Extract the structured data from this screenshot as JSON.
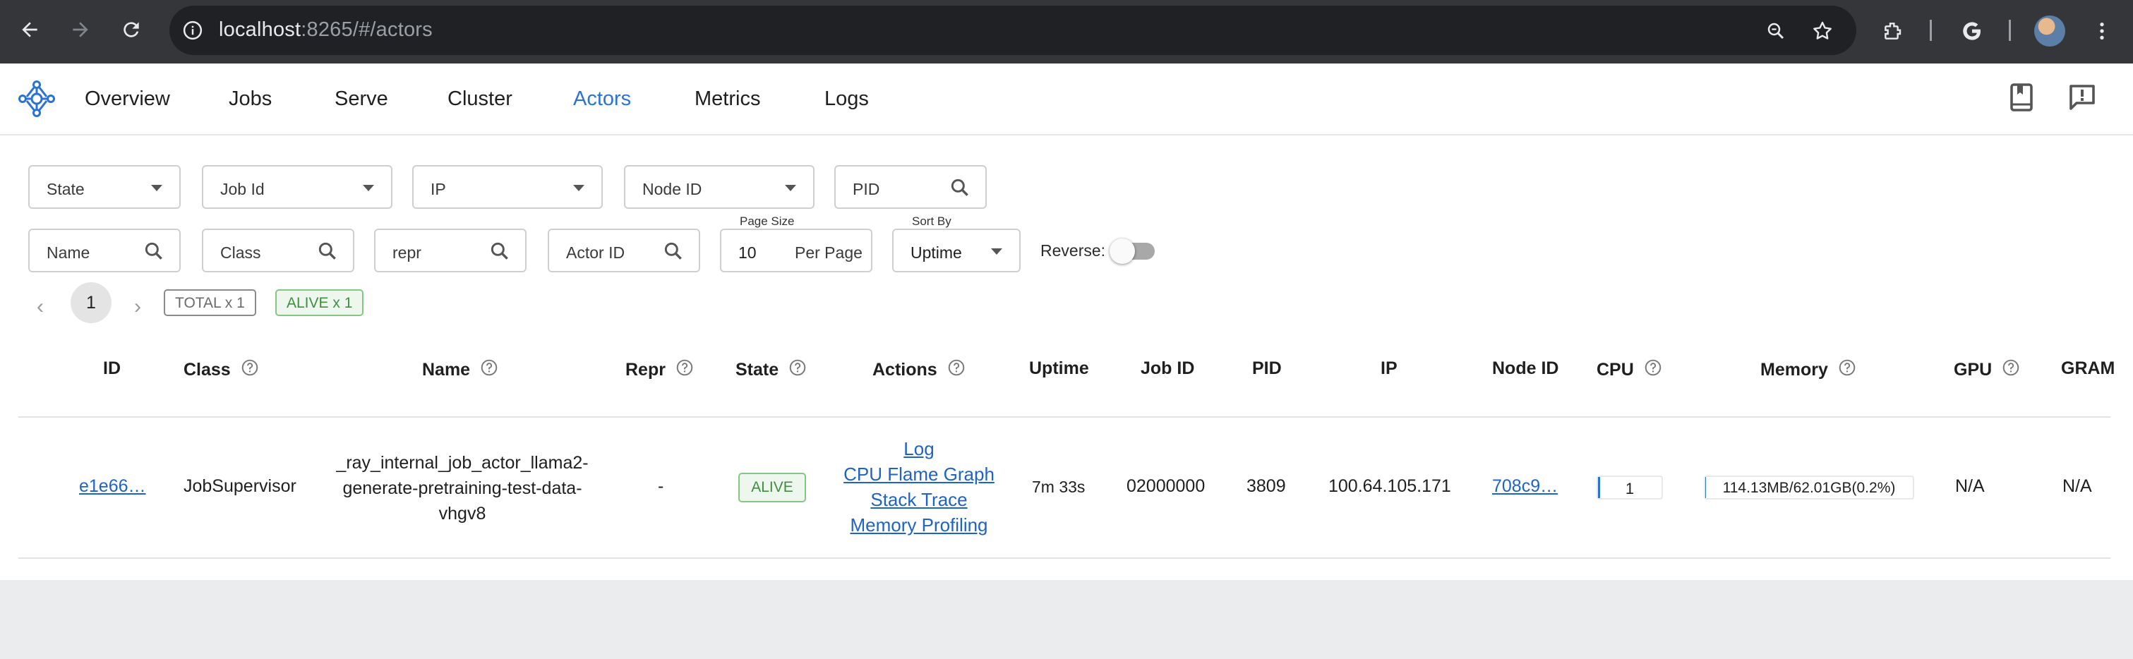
{
  "browser": {
    "url_host": "localhost",
    "url_rest": ":8265/#/actors"
  },
  "nav": {
    "items": [
      "Overview",
      "Jobs",
      "Serve",
      "Cluster",
      "Actors",
      "Metrics",
      "Logs"
    ],
    "active": "Actors"
  },
  "filters": {
    "state": "State",
    "job_id": "Job Id",
    "ip": "IP",
    "node_id": "Node ID",
    "pid": "PID",
    "name": "Name",
    "class": "Class",
    "repr": "repr",
    "actor_id": "Actor ID",
    "page_size_label": "Page Size",
    "page_size_value": "10",
    "page_size_suffix": "Per Page",
    "sort_by_label": "Sort By",
    "sort_by_value": "Uptime",
    "reverse_label": "Reverse:",
    "reverse_on": false
  },
  "pagination": {
    "prev": "‹",
    "page": "1",
    "next": "›",
    "total_chip": "TOTAL x 1",
    "alive_chip": "ALIVE x 1"
  },
  "table": {
    "headers": {
      "id": "ID",
      "class": "Class",
      "name": "Name",
      "repr": "Repr",
      "state": "State",
      "actions": "Actions",
      "uptime": "Uptime",
      "job_id": "Job ID",
      "pid": "PID",
      "ip": "IP",
      "node_id": "Node ID",
      "cpu": "CPU",
      "memory": "Memory",
      "gpu": "GPU",
      "gram": "GRAM"
    },
    "row": {
      "id": "e1e66…",
      "class": "JobSupervisor",
      "name_lines": [
        "_ray_internal_job_actor_llama2-",
        "generate-pretraining-test-data-",
        "vhgv8"
      ],
      "repr": "-",
      "state": "ALIVE",
      "actions": [
        "Log",
        "CPU Flame Graph",
        "Stack Trace",
        "Memory Profiling"
      ],
      "uptime": "7m 33s",
      "job_id": "02000000",
      "pid": "3809",
      "ip": "100.64.105.171",
      "node_id": "708c9…",
      "cpu": "1",
      "cpu_fraction": 0.01,
      "memory": "114.13MB/62.01GB(0.2%)",
      "memory_fraction": 0.002,
      "gpu": "N/A",
      "gram": "N/A"
    }
  },
  "colors": {
    "accent": "#2a73d6",
    "alive_green": "#3e8e3e",
    "chrome_bg": "#35363a"
  }
}
